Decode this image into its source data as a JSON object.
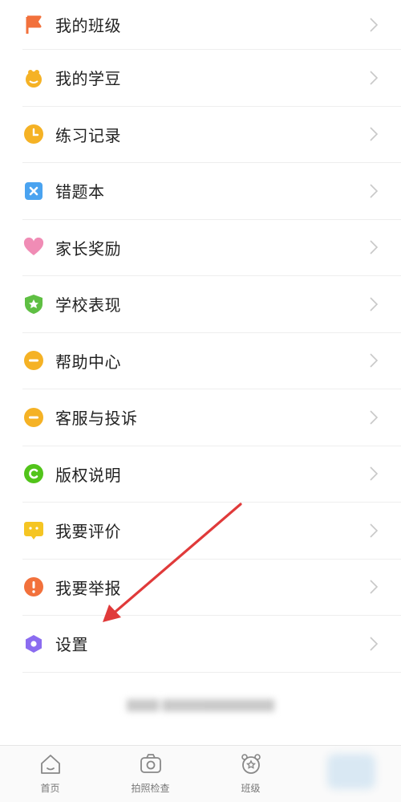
{
  "menu": {
    "items": [
      {
        "label": "我的班级",
        "icon": "flag-icon",
        "color": "#F2713C"
      },
      {
        "label": "我的学豆",
        "icon": "bean-icon",
        "color": "#F5B225"
      },
      {
        "label": "练习记录",
        "icon": "clock-icon",
        "color": "#F5B225"
      },
      {
        "label": "错题本",
        "icon": "wrong-book-icon",
        "color": "#4AA3F0"
      },
      {
        "label": "家长奖励",
        "icon": "heart-icon",
        "color": "#F08CB5"
      },
      {
        "label": "学校表现",
        "icon": "shield-icon",
        "color": "#5FBF43"
      },
      {
        "label": "帮助中心",
        "icon": "help-icon",
        "color": "#F5B225"
      },
      {
        "label": "客服与投诉",
        "icon": "service-icon",
        "color": "#F5B225"
      },
      {
        "label": "版权说明",
        "icon": "copyright-icon",
        "color": "#52C41A"
      },
      {
        "label": "我要评价",
        "icon": "comment-icon",
        "color": "#F5C523"
      },
      {
        "label": "我要举报",
        "icon": "report-icon",
        "color": "#F2713C"
      },
      {
        "label": "设置",
        "icon": "settings-icon",
        "color": "#8B6CF0"
      }
    ]
  },
  "tabbar": {
    "tabs": [
      {
        "label": "首页",
        "icon": "home-icon"
      },
      {
        "label": "拍照检查",
        "icon": "camera-icon"
      },
      {
        "label": "班级",
        "icon": "class-icon"
      }
    ]
  },
  "annotation": {
    "color": "#E03A3A"
  }
}
